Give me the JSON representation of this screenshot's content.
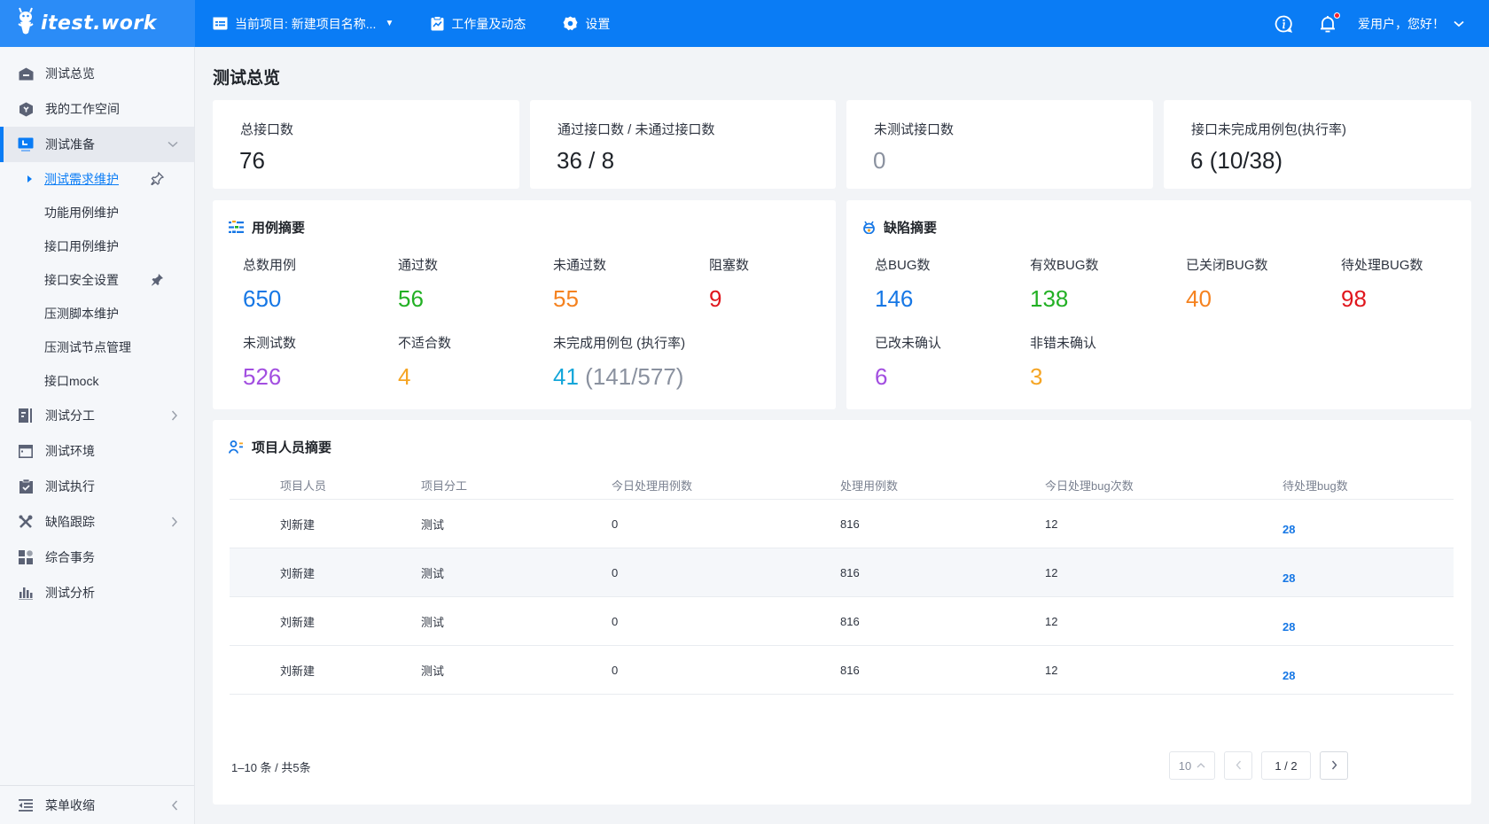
{
  "topbar": {
    "logo_text": "itest.work",
    "project_label": "当前项目: 新建项目名称...",
    "workload_label": "工作量及动态",
    "settings_label": "设置",
    "user_greeting": "爱用户，您好！",
    "has_notification": true
  },
  "sidebar": {
    "items": [
      {
        "label": "测试总览",
        "icon": "home-icon"
      },
      {
        "label": "我的工作空间",
        "icon": "workspace-icon"
      },
      {
        "label": "测试准备",
        "icon": "monitor-icon",
        "expanded": true,
        "active": true
      },
      {
        "label": "测试分工",
        "icon": "division-icon",
        "has_children": true
      },
      {
        "label": "测试环境",
        "icon": "window-icon"
      },
      {
        "label": "测试执行",
        "icon": "clipboard-check-icon"
      },
      {
        "label": "缺陷跟踪",
        "icon": "tools-icon",
        "has_children": true
      },
      {
        "label": "综合事务",
        "icon": "grid-icon"
      },
      {
        "label": "测试分析",
        "icon": "bar-chart-icon"
      }
    ],
    "sub_items": [
      {
        "label": "测试需求维护",
        "current": true,
        "pin": "outline"
      },
      {
        "label": "功能用例维护"
      },
      {
        "label": "接口用例维护"
      },
      {
        "label": "接口安全设置",
        "pin": "filled"
      },
      {
        "label": "压测脚本维护"
      },
      {
        "label": "压测试节点管理"
      },
      {
        "label": "接口mock"
      }
    ],
    "collapse_label": "菜单收缩"
  },
  "page": {
    "title": "测试总览"
  },
  "stats": [
    {
      "label": "总接口数",
      "value": "76"
    },
    {
      "label": "通过接口数 / 未通过接口数",
      "value": "36 / 8"
    },
    {
      "label": "未测试接口数",
      "value": "0"
    },
    {
      "label": "接口未完成用例包(执行率)",
      "value": "6",
      "detail": "(10/38)"
    }
  ],
  "case_summary": {
    "title": "用例摘要",
    "metrics": [
      {
        "label": "总数用例",
        "value": "650",
        "color": "#1677e5"
      },
      {
        "label": "通过数",
        "value": "56",
        "color": "#22b024"
      },
      {
        "label": "未通过数",
        "value": "55",
        "color": "#f5821f"
      },
      {
        "label": "阻塞数",
        "value": "9",
        "color": "#e0161d"
      },
      {
        "label": "未测试数",
        "value": "526",
        "color": "#a24ee0"
      },
      {
        "label": "不适合数",
        "value": "4",
        "color": "#f5a524"
      },
      {
        "label": "未完成用例包 (执行率)",
        "value": "41",
        "detail": "(141/577)",
        "color": "#14a6d9"
      }
    ]
  },
  "bug_summary": {
    "title": "缺陷摘要",
    "metrics": [
      {
        "label": "总BUG数",
        "value": "146",
        "color": "#1677e5"
      },
      {
        "label": "有效BUG数",
        "value": "138",
        "color": "#22b024"
      },
      {
        "label": "已关闭BUG数",
        "value": "40",
        "color": "#f5821f"
      },
      {
        "label": "待处理BUG数",
        "value": "98",
        "color": "#e0161d"
      },
      {
        "label": "已改未确认",
        "value": "6",
        "color": "#a24ee0"
      },
      {
        "label": "非错未确认",
        "value": "3",
        "color": "#f5a524"
      }
    ]
  },
  "people_summary": {
    "title": "项目人员摘要",
    "columns": [
      "项目人员",
      "项目分工",
      "今日处理用例数",
      "处理用例数",
      "今日处理bug次数",
      "待处理bug数"
    ],
    "rows": [
      [
        "刘新建",
        "测试",
        "0",
        "816",
        "12",
        "28"
      ],
      [
        "刘新建",
        "测试",
        "0",
        "816",
        "12",
        "28"
      ],
      [
        "刘新建",
        "测试",
        "0",
        "816",
        "12",
        "28"
      ],
      [
        "刘新建",
        "测试",
        "0",
        "816",
        "12",
        "28"
      ]
    ],
    "pagination": {
      "info": "1–10 条 / 共5条",
      "page_size": "10",
      "current": "1 / 2"
    }
  }
}
